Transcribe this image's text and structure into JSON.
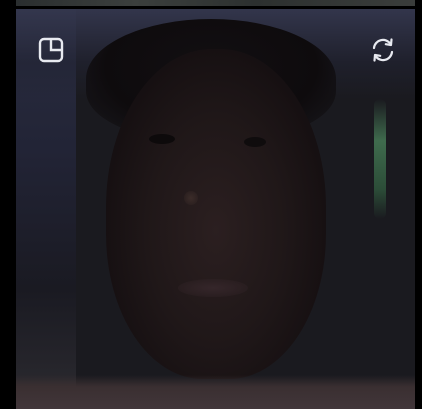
{
  "call": {
    "layout_button_icon": "picture-in-picture-icon",
    "switch_camera_icon": "switch-camera-icon",
    "icon_color": "#e8eaf0"
  }
}
